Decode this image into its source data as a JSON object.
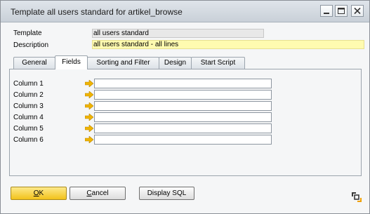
{
  "window": {
    "title": "Template all users standard for  artikel_browse"
  },
  "titlebar_buttons": [
    "minimize-icon",
    "maximize-icon",
    "close-icon"
  ],
  "fields": {
    "template_label": "Template",
    "template_value": "all users standard",
    "description_label": "Description",
    "description_value": "all users standard - all lines"
  },
  "tabs": [
    {
      "label": "General",
      "active": false
    },
    {
      "label": "Fields",
      "active": true
    },
    {
      "label": "Sorting and Filter",
      "active": false
    },
    {
      "label": "Design",
      "active": false
    },
    {
      "label": "Start Script",
      "active": false
    }
  ],
  "columns": [
    {
      "label": "Column 1",
      "value": ""
    },
    {
      "label": "Column 2",
      "value": ""
    },
    {
      "label": "Column 3",
      "value": ""
    },
    {
      "label": "Column 4",
      "value": ""
    },
    {
      "label": "Column 5",
      "value": ""
    },
    {
      "label": "Column 6",
      "value": ""
    }
  ],
  "buttons": {
    "ok": "OK",
    "cancel": "Cancel",
    "display_sql": "Display SQL"
  },
  "colors": {
    "accent_yellow": "#fffbb0",
    "ok_button": "#f2c21a",
    "link_arrow": "#f0b400",
    "readonly_field": "#e8e8e8"
  }
}
